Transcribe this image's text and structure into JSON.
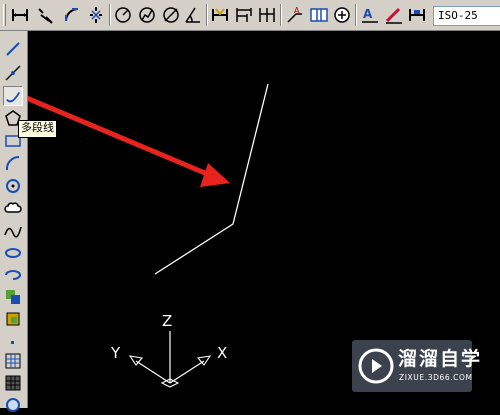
{
  "toolbar": {
    "icons": [
      "linear-dimension-icon",
      "aligned-dimension-icon",
      "arc-length-icon",
      "ordinate-dimension-icon",
      "radius-dimension-icon",
      "jogged-icon",
      "diameter-dimension-icon",
      "angular-dimension-icon",
      "quick-dimension-icon",
      "baseline-icon",
      "continue-icon",
      "quick-leader-icon",
      "tolerance-icon",
      "center-mark-icon",
      "dimension-edit-icon",
      "dimension-text-edit-icon",
      "dimension-update-icon"
    ],
    "dimension_style": "ISO-25"
  },
  "draw_toolbar": {
    "icons": [
      "line-icon",
      "construction-line-icon",
      "polyline-icon",
      "polygon-icon",
      "rectangle-icon",
      "arc-icon",
      "circle-icon",
      "revision-cloud-icon",
      "spline-icon",
      "ellipse-icon",
      "ellipse-arc-icon",
      "insert-block-icon",
      "make-block-icon",
      "point-icon",
      "hatch-icon",
      "gradient-icon",
      "region-icon"
    ],
    "active": "polyline-icon",
    "tooltip": "多段线"
  },
  "ucs": {
    "z": "Z",
    "x": "X",
    "y": "Y"
  },
  "watermark": {
    "title": "溜溜自学",
    "url": "ZIXUE.3D66.COM"
  },
  "colors": {
    "canvas": "#000000",
    "toolbar": "#d4d0c8",
    "arrow": "#e8231e",
    "line": "#ffffff",
    "tooltip": "#ffffe1"
  }
}
